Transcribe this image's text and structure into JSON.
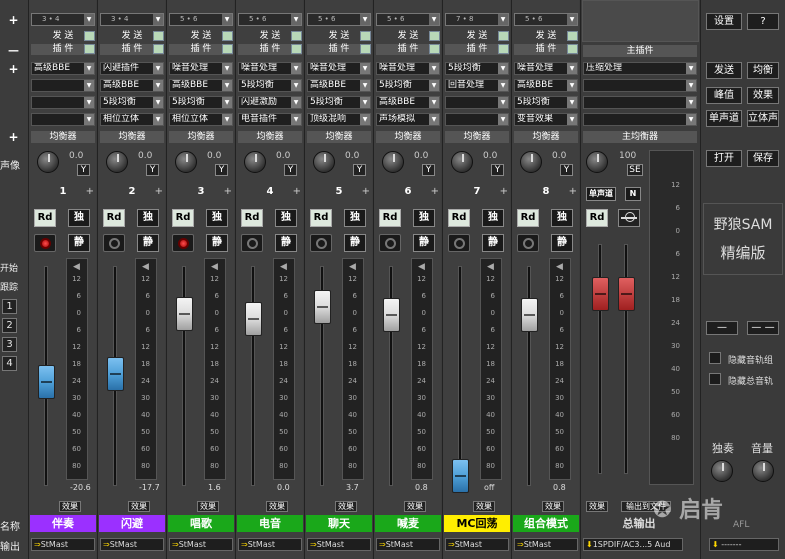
{
  "left_labels": {
    "add_top": "+",
    "add_plugin": "+",
    "add_eq": "+",
    "pan": "声像",
    "ch_minus": "—",
    "start": "开始",
    "track": "跟踪",
    "name": "名称",
    "output": "输出",
    "track_nums": [
      "1",
      "2",
      "3",
      "4"
    ]
  },
  "send_label": "发 送",
  "plugin_label": "插 件",
  "eq_label": "均衡器",
  "effect_label": "效果",
  "channels": [
    {
      "num": "1",
      "ratio": "3 • 4",
      "plugins": [
        "高级BBE",
        "",
        "",
        ""
      ],
      "pan": "0.0",
      "rec": true,
      "fader_val": "-20.6",
      "name": "伴奏",
      "name_color": "#9b30ff",
      "name_text": "#ffffff",
      "output": "StMast"
    },
    {
      "num": "2",
      "ratio": "3 • 4",
      "plugins": [
        "闪避插件",
        "高级BBE",
        "5段均衡",
        "相位立体"
      ],
      "pan": "0.0",
      "rec": false,
      "fader_val": "-17.7",
      "name": "闪避",
      "name_color": "#9b30ff",
      "name_text": "#ffffff",
      "output": "StMast"
    },
    {
      "num": "3",
      "ratio": "5 • 6",
      "plugins": [
        "噪音处理",
        "高级BBE",
        "5段均衡",
        "相位立体"
      ],
      "pan": "0.0",
      "rec": true,
      "fader_val": "1.6",
      "name": "唱歌",
      "name_color": "#1aa81a",
      "name_text": "#ffffff",
      "output": "StMast"
    },
    {
      "num": "4",
      "ratio": "5 • 6",
      "plugins": [
        "噪音处理",
        "5段均衡",
        "闪避激励",
        "电音插件"
      ],
      "pan": "0.0",
      "rec": false,
      "fader_val": "0.0",
      "name": "电音",
      "name_color": "#1aa81a",
      "name_text": "#ffffff",
      "output": "StMast"
    },
    {
      "num": "5",
      "ratio": "5 • 6",
      "plugins": [
        "噪音处理",
        "高级BBE",
        "5段均衡",
        "顶级混响"
      ],
      "pan": "0.0",
      "rec": false,
      "fader_val": "3.7",
      "name": "聊天",
      "name_color": "#1aa81a",
      "name_text": "#ffffff",
      "output": "StMast"
    },
    {
      "num": "6",
      "ratio": "5 • 6",
      "plugins": [
        "噪音处理",
        "5段均衡",
        "高级BBE",
        "声场模拟"
      ],
      "pan": "0.0",
      "rec": false,
      "fader_val": "0.8",
      "name": "喊麦",
      "name_color": "#1aa81a",
      "name_text": "#ffffff",
      "output": "StMast"
    },
    {
      "num": "7",
      "ratio": "7 • 8",
      "plugins": [
        "5段均衡",
        "回音处理",
        "",
        ""
      ],
      "pan": "0.0",
      "rec": false,
      "fader_val": "off",
      "name": "MC回荡",
      "name_color": "#ffee00",
      "name_text": "#000000",
      "output": "StMast"
    },
    {
      "num": "8",
      "ratio": "5 • 6",
      "plugins": [
        "噪音处理",
        "高级BBE",
        "5段均衡",
        "变音效果"
      ],
      "pan": "0.0",
      "rec": false,
      "fader_val": "0.8",
      "name": "组合模式",
      "name_color": "#1aa81a",
      "name_text": "#ffffff",
      "output": "StMast"
    }
  ],
  "master": {
    "plugin_title": "主插件",
    "plugins": [
      "压缩处理",
      "",
      "",
      ""
    ],
    "eq": "主均衡器",
    "pan": "100",
    "se": "SE",
    "mono": "单声道",
    "n": "N",
    "rd": "Rd",
    "out_file": "输出到文件",
    "name": "总输出",
    "output": "1SPDIF/AC3...5 Aud"
  },
  "right": {
    "settings": "设置",
    "help": "?",
    "send": "发送",
    "eq": "均衡",
    "peak": "峰值",
    "effect": "效果",
    "mono": "单声道",
    "stereo": "立体声",
    "open": "打开",
    "save": "保存",
    "brand1": "野狼SAM",
    "brand2": "精编版",
    "minus1": "—",
    "minus2": "— —",
    "hide_tracks": "隐藏音轨组",
    "hide_master": "隐藏总音轨",
    "solo": "独奏",
    "volume": "音量",
    "afl": "AFL",
    "watermark": "启肯"
  },
  "meter_ticks": [
    "12",
    "6",
    "0",
    "6",
    "12",
    "18",
    "24",
    "30",
    "40",
    "50",
    "60",
    "80"
  ],
  "colors": {
    "fader_blue": "#4fa0d8",
    "fader_white": "#dcdcdc",
    "fader_red": "#c03030"
  }
}
